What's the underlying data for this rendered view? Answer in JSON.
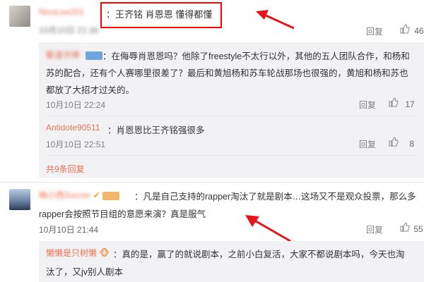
{
  "accent": "#eb7350",
  "annotation_color": "#e8141b",
  "comments": [
    {
      "user": "NicoLee201",
      "text": "：王齐铭 肖恩恩 懂得都懂",
      "time": "10月10日 21:38",
      "reply": "回复",
      "likes": "46"
    },
    {
      "user": "繁逢许棒",
      "text_line1": "：在侮辱肖恩恩吗？他除了freestyle不太行以外，其他的五人团队合作，和杨和",
      "text_line2": "苏的配合，还有个人赛哪里很差了？最后和黄旭杨和苏车轮战那场也很强的，黄旭和杨和苏也",
      "text_line3": "都放了大招才过关的。",
      "time": "10月10日 22:24",
      "reply": "回复",
      "likes": "17"
    },
    {
      "user": "Antidote90511",
      "text": "：肖恩恩比王齐铭强很多",
      "time": "10月10日 22:51",
      "reply": "回复",
      "likes": "8"
    },
    {
      "user": "梅小西Soccer",
      "text_line1": "：凡是自己支持的rapper淘汰了就是剧本…这场又不是观众投票，那么多",
      "text_line2": "rapper会按照节目组的意愿来演？真是服气",
      "time": "10月10日 21:44",
      "reply": "回复",
      "likes": "55"
    },
    {
      "user": "懒懒是只树懒",
      "text_line1": "：真的是，赢了的就说剧本，之前小白复活，大家不都说剧本吗，今天也淘",
      "text_line2": "汰了，又jv别人剧本"
    }
  ],
  "more_replies": "共9条回复"
}
